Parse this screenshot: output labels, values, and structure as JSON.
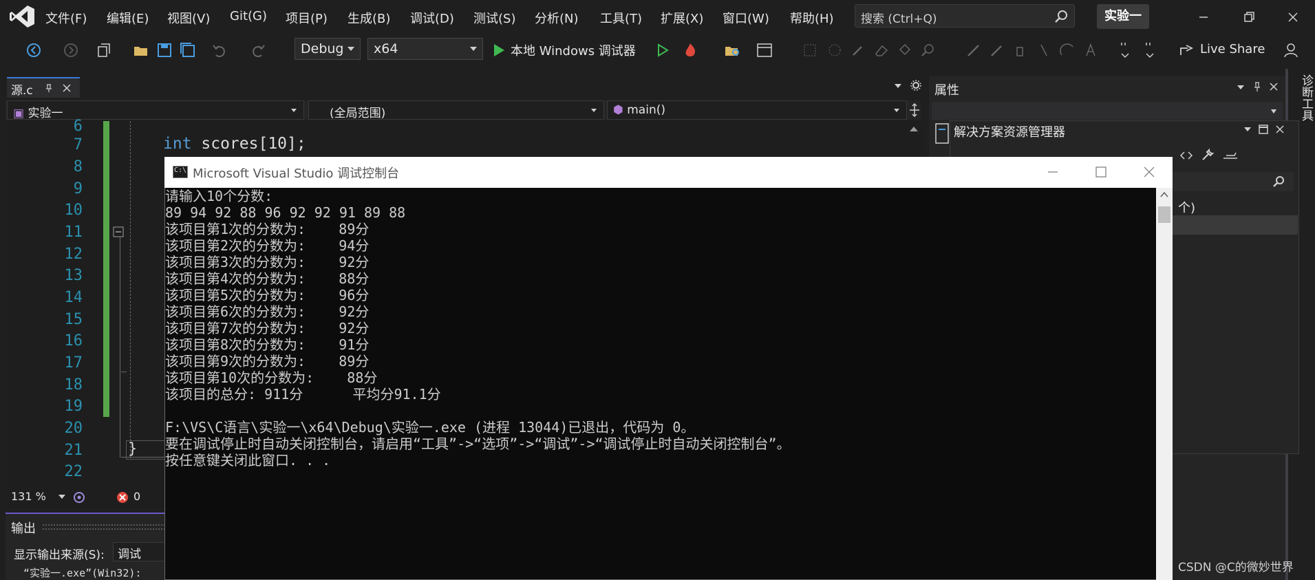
{
  "menu": {
    "items": [
      "文件(F)",
      "编辑(E)",
      "视图(V)",
      "Git(G)",
      "项目(P)",
      "生成(B)",
      "调试(D)",
      "测试(S)",
      "分析(N)",
      "工具(T)",
      "扩展(X)",
      "窗口(W)",
      "帮助(H)"
    ],
    "search_placeholder": "搜索 (Ctrl+Q)",
    "project_badge": "实验一"
  },
  "toolbar": {
    "config": "Debug",
    "platform": "x64",
    "run_label": "本地 Windows 调试器",
    "live_share": "Live Share"
  },
  "document": {
    "tab_label": "源.c",
    "nav_project": "实验一",
    "nav_scope": "(全局范围)",
    "nav_member": "main()"
  },
  "editor": {
    "line_numbers": [
      "6",
      "7",
      "8",
      "9",
      "10",
      "11",
      "12",
      "13",
      "14",
      "15",
      "16",
      "17",
      "18",
      "19",
      "20",
      "21",
      "22"
    ],
    "code_keyword": "int",
    "code_rest": " scores[10];",
    "zoom": "131 %",
    "error_count": "0",
    "fold_brace": "}"
  },
  "output": {
    "title": "输出",
    "source_label": "显示输出来源(S):",
    "source_value": "调试",
    "line": "“实验一.exe”(Win32):"
  },
  "properties": {
    "title": "属性"
  },
  "solution_explorer": {
    "title": "解决方案资源管理器",
    "fragment": "个)"
  },
  "diagnostics": {
    "tab": "诊断工具"
  },
  "console": {
    "title": "Microsoft Visual Studio 调试控制台",
    "icon_text": "C:\\",
    "lines": [
      "请输入10个分数:",
      "89 94 92 88 96 92 92 91 89 88",
      "该项目第1次的分数为:    89分",
      "该项目第2次的分数为:    94分",
      "该项目第3次的分数为:    92分",
      "该项目第4次的分数为:    88分",
      "该项目第5次的分数为:    96分",
      "该项目第6次的分数为:    92分",
      "该项目第7次的分数为:    92分",
      "该项目第8次的分数为:    91分",
      "该项目第9次的分数为:    89分",
      "该项目第10次的分数为:    88分",
      "该项目的总分: 911分      平均分91.1分",
      "",
      "F:\\VS\\C语言\\实验一\\x64\\Debug\\实验一.exe (进程 13044)已退出，代码为 0。",
      "要在调试停止时自动关闭控制台，请启用“工具”->“选项”->“调试”->“调试停止时自动关闭控制台”。",
      "按任意键关闭此窗口. . ."
    ]
  },
  "watermark": "CSDN @C的微妙世界",
  "colors": {
    "line_number": "#2b91af",
    "change_bar": "#57a64a",
    "keyword": "#569cd6",
    "identifier": "#9cdcfe",
    "console_bg": "#0c0c0c"
  }
}
